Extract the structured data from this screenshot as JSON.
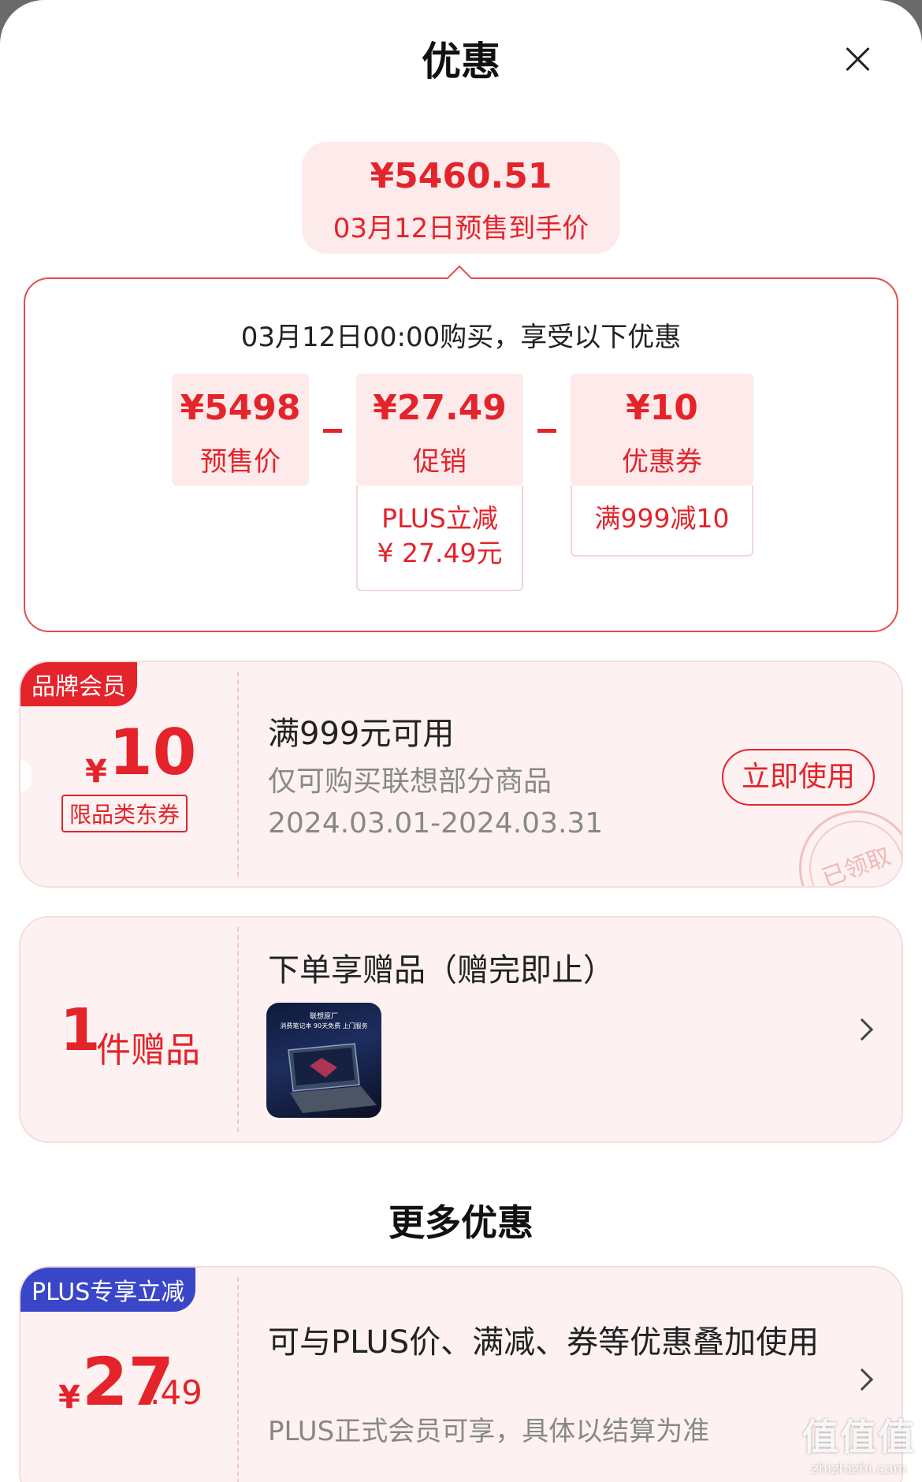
{
  "header": {
    "title": "优惠"
  },
  "summary": {
    "amount": "¥5460.51",
    "label": "03月12日预售到手价"
  },
  "calc": {
    "headline": "03月12日00:00购买，享受以下优惠",
    "presale": {
      "value": "¥5498",
      "label": "预售价"
    },
    "promo": {
      "value": "¥27.49",
      "label": "促销",
      "detail_line1": "PLUS立减",
      "detail_line2": "¥ 27.49元"
    },
    "coupon": {
      "value": "¥10",
      "label": "优惠券",
      "detail": "满999减10"
    }
  },
  "brand_coupon": {
    "tag": "品牌会员",
    "currency": "¥",
    "value": "10",
    "type": "限品类东券",
    "title": "满999元可用",
    "scope": "仅可购买联想部分商品",
    "validity": "2024.03.01-2024.03.31",
    "action": "立即使用",
    "stamp": "已领取"
  },
  "gift": {
    "count": "1",
    "unit": "件赠品",
    "title": "下单享赠品（赠完即止）",
    "image_caption_1": "联想原厂",
    "image_caption_2": "消费笔记本 90天免费 上门服务"
  },
  "more": {
    "title": "更多优惠",
    "plus_offer": {
      "tag": "PLUS专享立减",
      "currency": "¥",
      "value_int": "27",
      "value_dec": ".49",
      "title": "可与PLUS价、满减、券等优惠叠加使用",
      "note": "PLUS正式会员可享，具体以结算为准"
    }
  },
  "watermark": {
    "logo": "值值值",
    "domain": "zhizhizhi.com"
  }
}
